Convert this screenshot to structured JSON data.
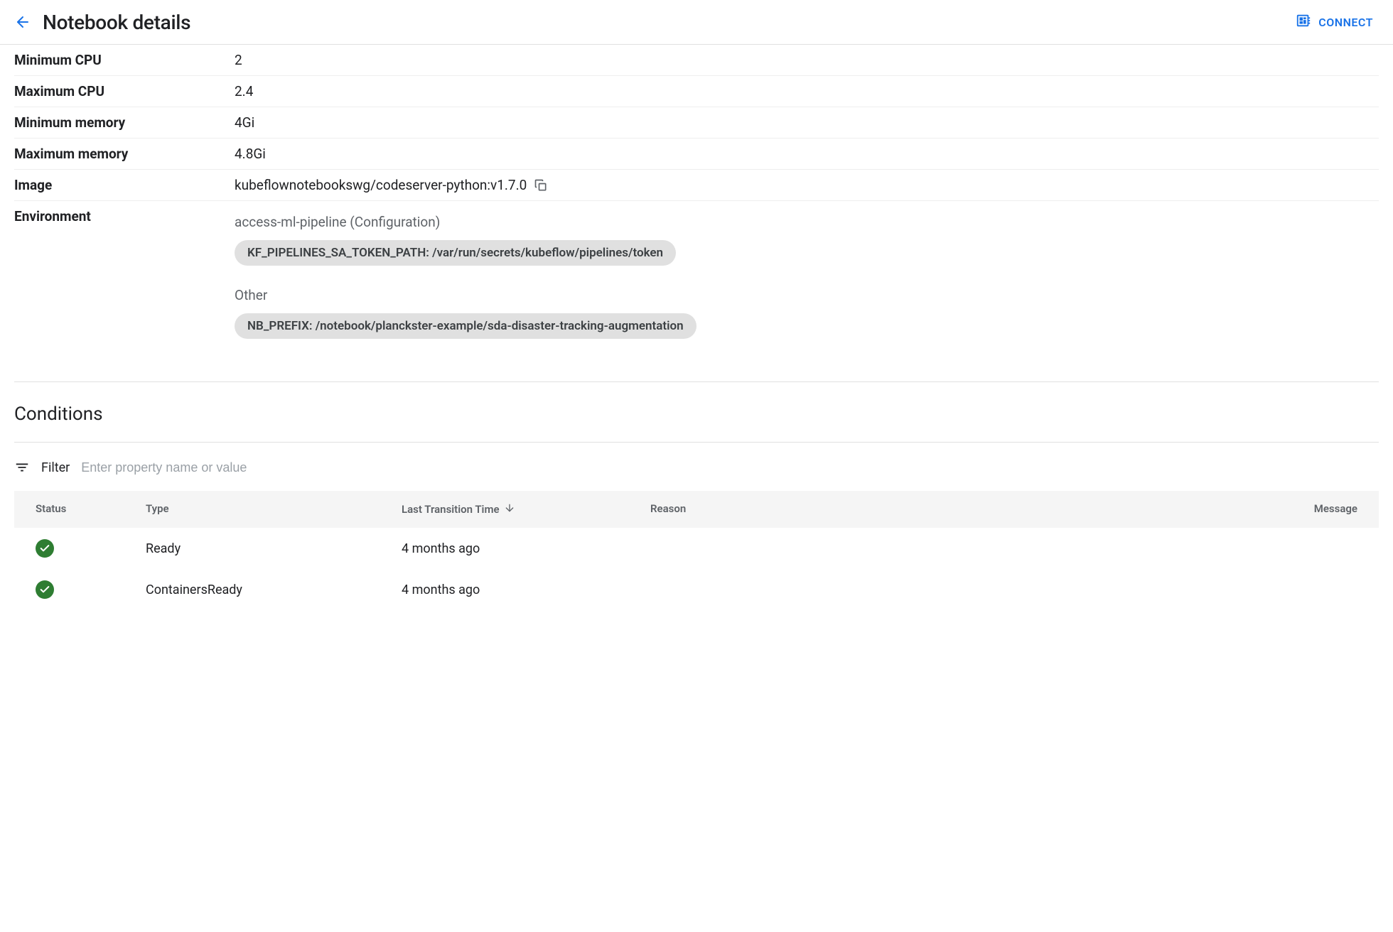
{
  "header": {
    "title": "Notebook details",
    "connect_label": "CONNECT"
  },
  "details": {
    "min_cpu_label": "Minimum CPU",
    "min_cpu_value": "2",
    "max_cpu_label": "Maximum CPU",
    "max_cpu_value": "2.4",
    "min_memory_label": "Minimum memory",
    "min_memory_value": "4Gi",
    "max_memory_label": "Maximum memory",
    "max_memory_value": "4.8Gi",
    "image_label": "Image",
    "image_value": "kubeflownotebookswg/codeserver-python:v1.7.0",
    "environment_label": "Environment"
  },
  "environment": {
    "groups": [
      {
        "title": "access-ml-pipeline (Configuration)",
        "chip": "KF_PIPELINES_SA_TOKEN_PATH: /var/run/secrets/kubeflow/pipelines/token"
      },
      {
        "title": "Other",
        "chip": "NB_PREFIX: /notebook/planckster-example/sda-disaster-tracking-augmentation"
      }
    ]
  },
  "conditions": {
    "title": "Conditions",
    "filter_label": "Filter",
    "filter_placeholder": "Enter property name or value",
    "columns": {
      "status": "Status",
      "type": "Type",
      "time": "Last Transition Time",
      "reason": "Reason",
      "message": "Message"
    },
    "rows": [
      {
        "type": "Ready",
        "time": "4 months ago"
      },
      {
        "type": "ContainersReady",
        "time": "4 months ago"
      }
    ]
  }
}
